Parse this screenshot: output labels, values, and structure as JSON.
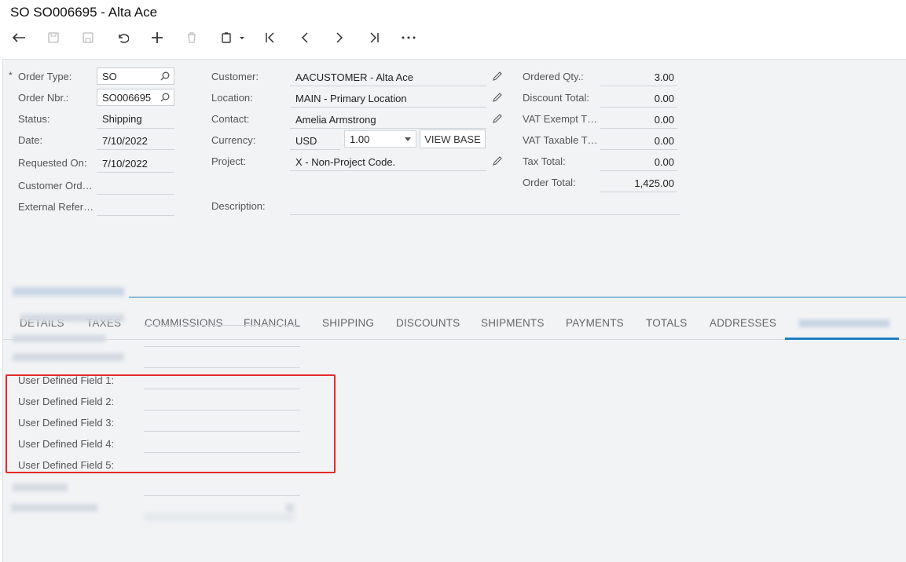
{
  "window": {
    "title": "SO SO006695 - Alta Ace"
  },
  "summary": {
    "order_type": {
      "label": "Order Type:",
      "value": "SO",
      "required_marker": "*"
    },
    "order_nbr": {
      "label": "Order Nbr.:",
      "value": "SO006695"
    },
    "status": {
      "label": "Status:",
      "value": "Shipping"
    },
    "date": {
      "label": "Date:",
      "value": "7/10/2022"
    },
    "requested_on": {
      "label": "Requested On:",
      "value": "7/10/2022"
    },
    "customer_ord": {
      "label": "Customer Ord…",
      "value": ""
    },
    "external_ref": {
      "label": "External Refer…",
      "value": ""
    },
    "customer": {
      "label": "Customer:",
      "value": "AACUSTOMER - Alta Ace"
    },
    "location": {
      "label": "Location:",
      "value": "MAIN - Primary Location"
    },
    "contact": {
      "label": "Contact:",
      "value": "Amelia Armstrong"
    },
    "currency": {
      "label": "Currency:",
      "value": "USD",
      "rate": "1.00",
      "view_base_label": "VIEW BASE"
    },
    "project": {
      "label": "Project:",
      "value": "X - Non-Project Code."
    },
    "description": {
      "label": "Description:",
      "value": ""
    },
    "ordered_qty": {
      "label": "Ordered Qty.:",
      "value": "3.00"
    },
    "discount_total": {
      "label": "Discount Total:",
      "value": "0.00"
    },
    "vat_exempt": {
      "label": "VAT Exempt T…",
      "value": "0.00"
    },
    "vat_taxable": {
      "label": "VAT Taxable T…",
      "value": "0.00"
    },
    "tax_total": {
      "label": "Tax Total:",
      "value": "0.00"
    },
    "order_total": {
      "label": "Order Total:",
      "value": "1,425.00"
    }
  },
  "tabs": [
    "DETAILS",
    "TAXES",
    "COMMISSIONS",
    "FINANCIAL",
    "SHIPPING",
    "DISCOUNTS",
    "SHIPMENTS",
    "PAYMENTS",
    "TOTALS",
    "ADDRESSES"
  ],
  "udf": {
    "field1": "User Defined Field 1:",
    "field2": "User Defined Field 2:",
    "field3": "User Defined Field 3:",
    "field4": "User Defined Field 4:",
    "field5": "User Defined Field 5:"
  },
  "colors": {
    "accent": "#1e7fc3",
    "highlight": "#e52b2b"
  }
}
